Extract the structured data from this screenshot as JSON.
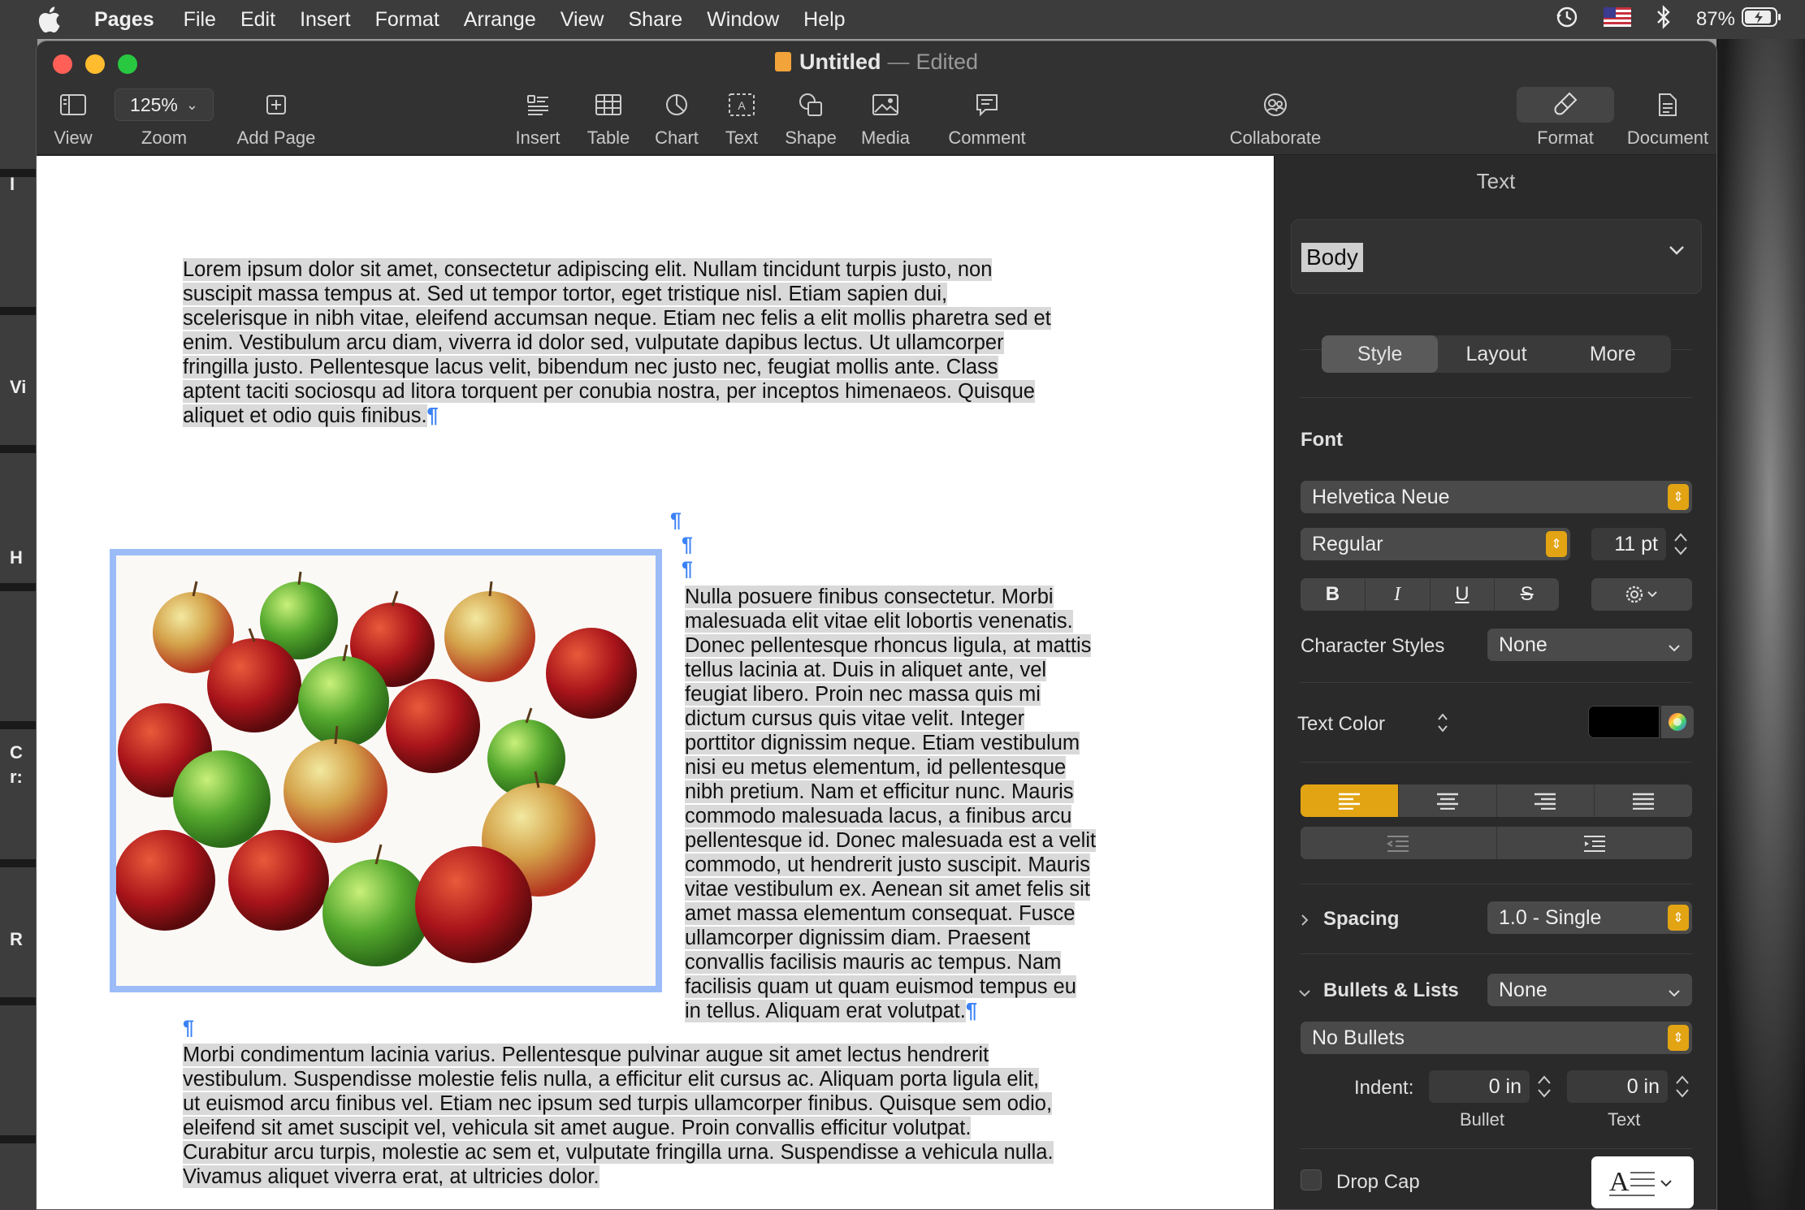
{
  "menubar": {
    "app": "Pages",
    "items": [
      "File",
      "Edit",
      "Insert",
      "Format",
      "Arrange",
      "View",
      "Share",
      "Window",
      "Help"
    ],
    "battery": "87%"
  },
  "window": {
    "title": "Untitled",
    "dash": "—",
    "status": "Edited"
  },
  "toolbar": {
    "view": "View",
    "zoom_value": "125%",
    "zoom": "Zoom",
    "add_page": "Add Page",
    "insert": "Insert",
    "table": "Table",
    "chart": "Chart",
    "text": "Text",
    "shape": "Shape",
    "media": "Media",
    "comment": "Comment",
    "collaborate": "Collaborate",
    "format": "Format",
    "document": "Document"
  },
  "desktop_labels": [
    "I",
    "Vi",
    "H",
    "C",
    "r:",
    "R"
  ],
  "document": {
    "para1_lines": [
      "Lorem ipsum dolor sit amet, consectetur adipiscing elit. Nullam tincidunt turpis justo, non",
      "suscipit massa tempus at. Sed ut tempor tortor, eget tristique nisl. Etiam sapien dui,",
      "scelerisque in nibh vitae, eleifend accumsan neque. Etiam nec felis a elit mollis pharetra sed et",
      "enim. Vestibulum arcu diam, viverra id dolor sed, vulputate dapibus lectus. Ut ullamcorper",
      "fringilla justo. Pellentesque lacus velit, bibendum nec justo nec, feugiat mollis ante. Class",
      "aptent taciti sociosqu ad litora torquent per conubia nostra, per inceptos himenaeos. Quisque",
      "aliquet et odio quis finibus."
    ],
    "para2_lines": [
      "Nulla posuere finibus consectetur. Morbi",
      "malesuada elit vitae elit lobortis venenatis.",
      "Donec pellentesque rhoncus ligula, at mattis",
      "tellus lacinia at. Duis in aliquet ante, vel",
      "feugiat libero. Proin nec massa quis mi",
      "dictum cursus quis vitae velit. Integer",
      "porttitor dignissim neque. Etiam vestibulum",
      "nisi eu metus elementum, id pellentesque",
      "nibh pretium. Nam et efficitur nunc. Mauris",
      "commodo malesuada lacus, a finibus arcu",
      "pellentesque id. Donec malesuada est a velit",
      "commodo, ut hendrerit justo suscipit. Mauris",
      "vitae vestibulum ex. Aenean sit amet felis sit",
      "amet massa elementum consequat. Fusce",
      "ullamcorper dignissim diam. Praesent",
      "convallis facilisis mauris ac tempus. Nam",
      "facilisis quam ut quam euismod tempus eu",
      "in tellus. Aliquam erat volutpat."
    ],
    "para3_lines": [
      "Morbi condimentum lacinia varius. Pellentesque pulvinar augue sit amet lectus hendrerit",
      "vestibulum. Suspendisse molestie felis nulla, a efficitur elit cursus ac. Aliquam porta ligula elit,",
      "ut euismod arcu finibus vel. Etiam nec ipsum sed turpis ullamcorper finibus. Quisque sem odio,",
      "eleifend sit amet suscipit vel, vehicula sit amet augue. Proin convallis efficitur volutpat.",
      "Curabitur arcu turpis, molestie ac sem et, vulputate fringilla urna. Suspendisse a vehicula nulla.",
      "Vivamus aliquet viverra erat, at ultricies dolor."
    ],
    "pilcrow": "¶"
  },
  "inspector": {
    "title": "Text",
    "paragraph_style": "Body",
    "tabs": [
      "Style",
      "Layout",
      "More"
    ],
    "active_tab": "Style",
    "font_label": "Font",
    "font_family": "Helvetica Neue",
    "font_face": "Regular",
    "font_size": "11 pt",
    "format_buttons": [
      "B",
      "I",
      "U",
      "S"
    ],
    "character_styles_label": "Character Styles",
    "character_styles_value": "None",
    "text_color_label": "Text Color",
    "text_color": "#000000",
    "spacing_label": "Spacing",
    "spacing_value": "1.0 - Single",
    "bullets_label": "Bullets & Lists",
    "bullets_value": "None",
    "bullet_type": "No Bullets",
    "indent_label": "Indent:",
    "bullet_indent": "0 in",
    "text_indent": "0 in",
    "bullet_caption": "Bullet",
    "text_caption": "Text",
    "drop_cap_label": "Drop Cap",
    "accent_color": "#e3a414"
  }
}
